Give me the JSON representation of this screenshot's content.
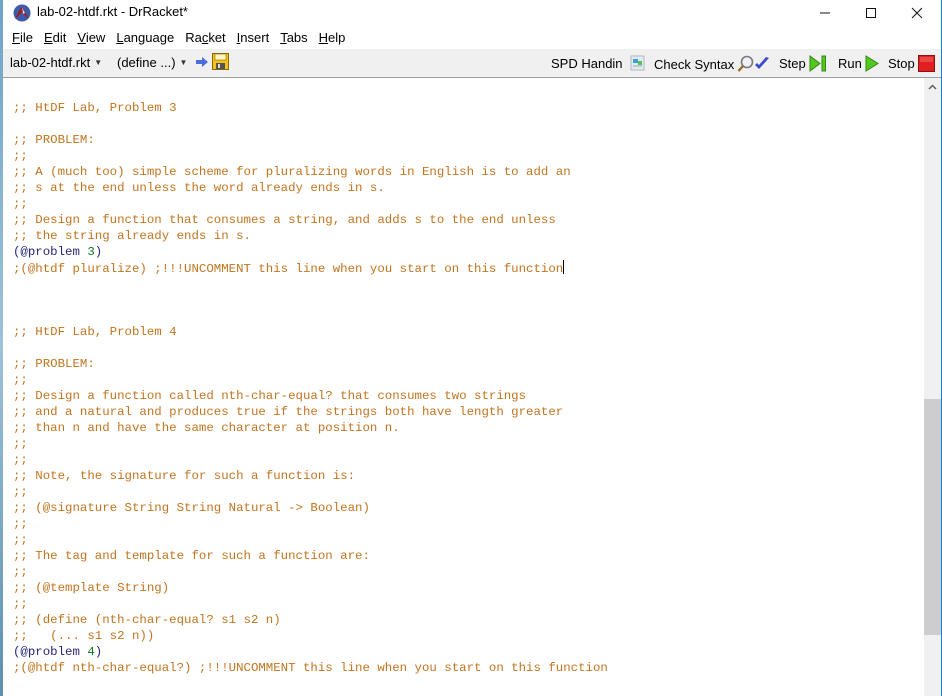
{
  "window": {
    "title": "lab-02-htdf.rkt - DrRacket*",
    "controls": {
      "minimize": "—",
      "maximize": "☐",
      "close": "✕"
    }
  },
  "menu": [
    {
      "label": "File",
      "accel": "F",
      "rest": "ile"
    },
    {
      "label": "Edit",
      "accel": "E",
      "rest": "dit"
    },
    {
      "label": "View",
      "accel": "V",
      "rest": "iew"
    },
    {
      "label": "Language",
      "accel": "L",
      "rest": "anguage"
    },
    {
      "label": "Racket",
      "pre": "Ra",
      "accel": "c",
      "rest": "ket"
    },
    {
      "label": "Insert",
      "accel": "I",
      "rest": "nsert"
    },
    {
      "label": "Tabs",
      "accel": "T",
      "rest": "abs"
    },
    {
      "label": "Help",
      "accel": "H",
      "rest": "elp"
    }
  ],
  "toolbar": {
    "file_dropdown": "lab-02-htdf.rkt",
    "define_dropdown": "(define ...)",
    "spd_handin": "SPD Handin",
    "check_syntax": "Check Syntax",
    "step": "Step",
    "run": "Run",
    "stop": "Stop"
  },
  "editor": {
    "lines": [
      {
        "t": ";; HtDF Lab, Problem 3"
      },
      {
        "t": ""
      },
      {
        "t": ";; PROBLEM:"
      },
      {
        "t": ";;"
      },
      {
        "t": ";; A (much too) simple scheme for pluralizing words in English is to add an"
      },
      {
        "t": ";; s at the end unless the word already ends in s."
      },
      {
        "t": ";;"
      },
      {
        "t": ";; Design a function that consumes a string, and adds s to the end unless"
      },
      {
        "t": ";; the string already ends in s."
      },
      {
        "kind": "problem",
        "kw": "(@problem ",
        "num": "3",
        "close": ")"
      },
      {
        "t": ";(@htdf pluralize) ;!!!UNCOMMENT this line when you start on this function",
        "cursor": true
      },
      {
        "t": ""
      },
      {
        "t": ""
      },
      {
        "t": ""
      },
      {
        "t": ";; HtDF Lab, Problem 4"
      },
      {
        "t": ""
      },
      {
        "t": ";; PROBLEM:"
      },
      {
        "t": ";;"
      },
      {
        "t": ";; Design a function called nth-char-equal? that consumes two strings"
      },
      {
        "t": ";; and a natural and produces true if the strings both have length greater"
      },
      {
        "t": ";; than n and have the same character at position n."
      },
      {
        "t": ";;"
      },
      {
        "t": ";;"
      },
      {
        "t": ";; Note, the signature for such a function is:"
      },
      {
        "t": ";;"
      },
      {
        "t": ";; (@signature String String Natural -> Boolean)"
      },
      {
        "t": ";;"
      },
      {
        "t": ";;"
      },
      {
        "t": ";; The tag and template for such a function are:"
      },
      {
        "t": ";;"
      },
      {
        "t": ";; (@template String)"
      },
      {
        "t": ";;"
      },
      {
        "t": ";; (define (nth-char-equal? s1 s2 n)"
      },
      {
        "t": ";;   (... s1 s2 n))"
      },
      {
        "kind": "problem",
        "kw": "(@problem ",
        "num": "4",
        "close": ")"
      },
      {
        "t": ";(@htdf nth-char-equal?) ;!!!UNCOMMENT this line when you start on this function"
      }
    ]
  },
  "scrollbar": {
    "position_fraction": 0.52,
    "visible_fraction": 0.38
  },
  "colors": {
    "comment": "#c2741f",
    "keyword": "#262680",
    "number": "#117722",
    "stop": "#e02020",
    "run": "#40c020"
  }
}
